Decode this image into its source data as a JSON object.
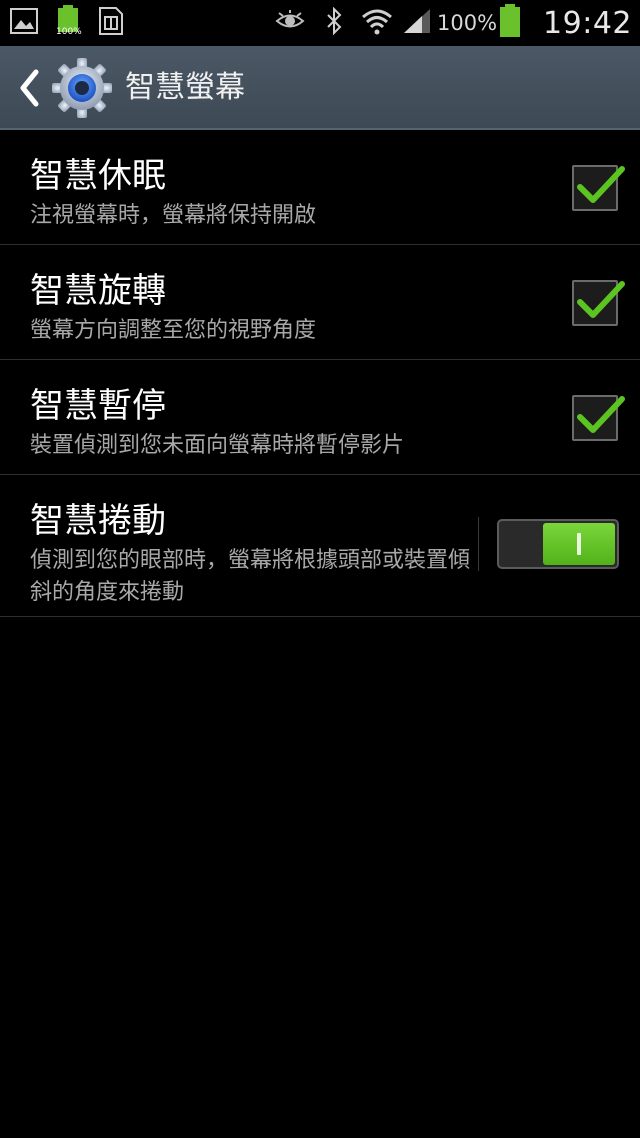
{
  "status_bar": {
    "battery_small_label": "100%",
    "battery_percent": "100%",
    "time": "19:42",
    "icons": [
      "gallery-icon",
      "battery-full-small-icon",
      "sim-card-icon",
      "smart-stay-eye-icon",
      "bluetooth-icon",
      "wifi-icon",
      "signal-icon",
      "battery-icon"
    ]
  },
  "action_bar": {
    "title": "智慧螢幕",
    "back_icon": "chevron-left-icon",
    "app_icon": "gear-icon"
  },
  "settings": [
    {
      "title": "智慧休眠",
      "subtitle": "注視螢幕時，螢幕將保持開啟",
      "control": "checkbox",
      "checked": true
    },
    {
      "title": "智慧旋轉",
      "subtitle": "螢幕方向調整至您的視野角度",
      "control": "checkbox",
      "checked": true
    },
    {
      "title": "智慧暫停",
      "subtitle": "裝置偵測到您未面向螢幕時將暫停影片",
      "control": "checkbox",
      "checked": true
    },
    {
      "title": "智慧捲動",
      "subtitle": "偵測到您的眼部時，螢幕將根據頭部或裝置傾斜的角度來捲動",
      "control": "switch",
      "on": true
    }
  ],
  "colors": {
    "accent_green": "#5cc421",
    "action_bar": "#46525e",
    "background": "#000000"
  }
}
